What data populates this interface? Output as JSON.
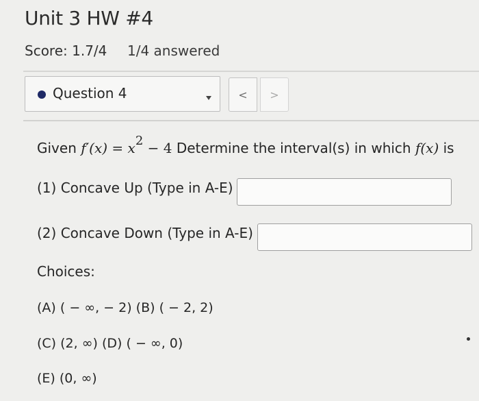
{
  "header": {
    "title": "Unit 3 HW #4",
    "score": "Score: 1.7/4",
    "answered": "1/4 answered"
  },
  "question_selector": {
    "label": "Question 4",
    "prev_label": "<",
    "next_label": ">"
  },
  "question": {
    "given_prefix": "Given ",
    "f_prime_expr": "f′(x)",
    "equals": " = ",
    "base": "x",
    "exponent": "2",
    "minus_four": " − 4",
    "instruction": " Determine the interval(s) in which ",
    "fx": "f(x)",
    "suffix": " is"
  },
  "fields": {
    "concave_up_label": "(1) Concave Up (Type in A-E)",
    "concave_up_value": "",
    "concave_down_label": "(2) Concave Down (Type in A-E)",
    "concave_down_value": ""
  },
  "choices": {
    "heading": "Choices:",
    "line1": "(A) ( − ∞,  − 2) (B) ( − 2, 2)",
    "line2": "(C) (2, ∞) (D) ( − ∞, 0)",
    "line3": "(E) (0, ∞)"
  }
}
